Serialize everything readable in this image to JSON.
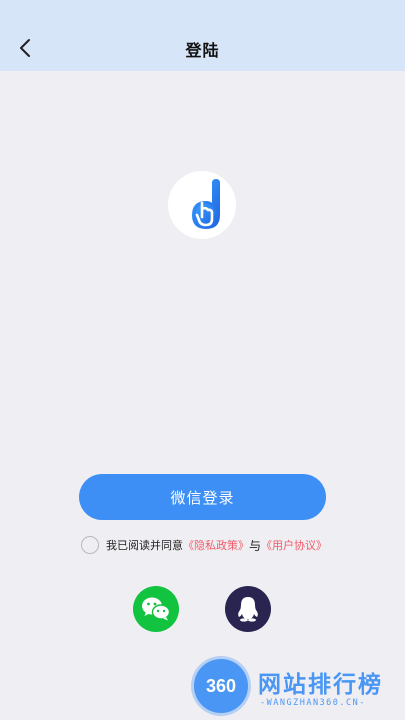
{
  "header": {
    "title": "登陆",
    "back_icon": "chevron-left-icon"
  },
  "logo": {
    "icon": "app-logo-d-icon",
    "color": "#2f7ff0"
  },
  "login": {
    "wechat_button_label": "微信登录"
  },
  "agreement": {
    "prefix": "我已阅读并同意",
    "privacy_link": "《隐私政策》",
    "and_text": "与",
    "user_link": "《用户协议》",
    "checked": false
  },
  "social": [
    {
      "name": "wechat",
      "icon": "wechat-icon",
      "color": "#11c33e"
    },
    {
      "name": "qq",
      "icon": "qq-penguin-icon",
      "color": "#2a2550"
    }
  ],
  "watermark": {
    "badge": "360",
    "title": "网站排行榜",
    "subtitle": "-WANGZHAN360.CN-"
  },
  "colors": {
    "header_bg": "#d6e5f8",
    "page_bg": "#efeff3",
    "primary": "#3d8ff5",
    "link": "#f05a6a"
  }
}
